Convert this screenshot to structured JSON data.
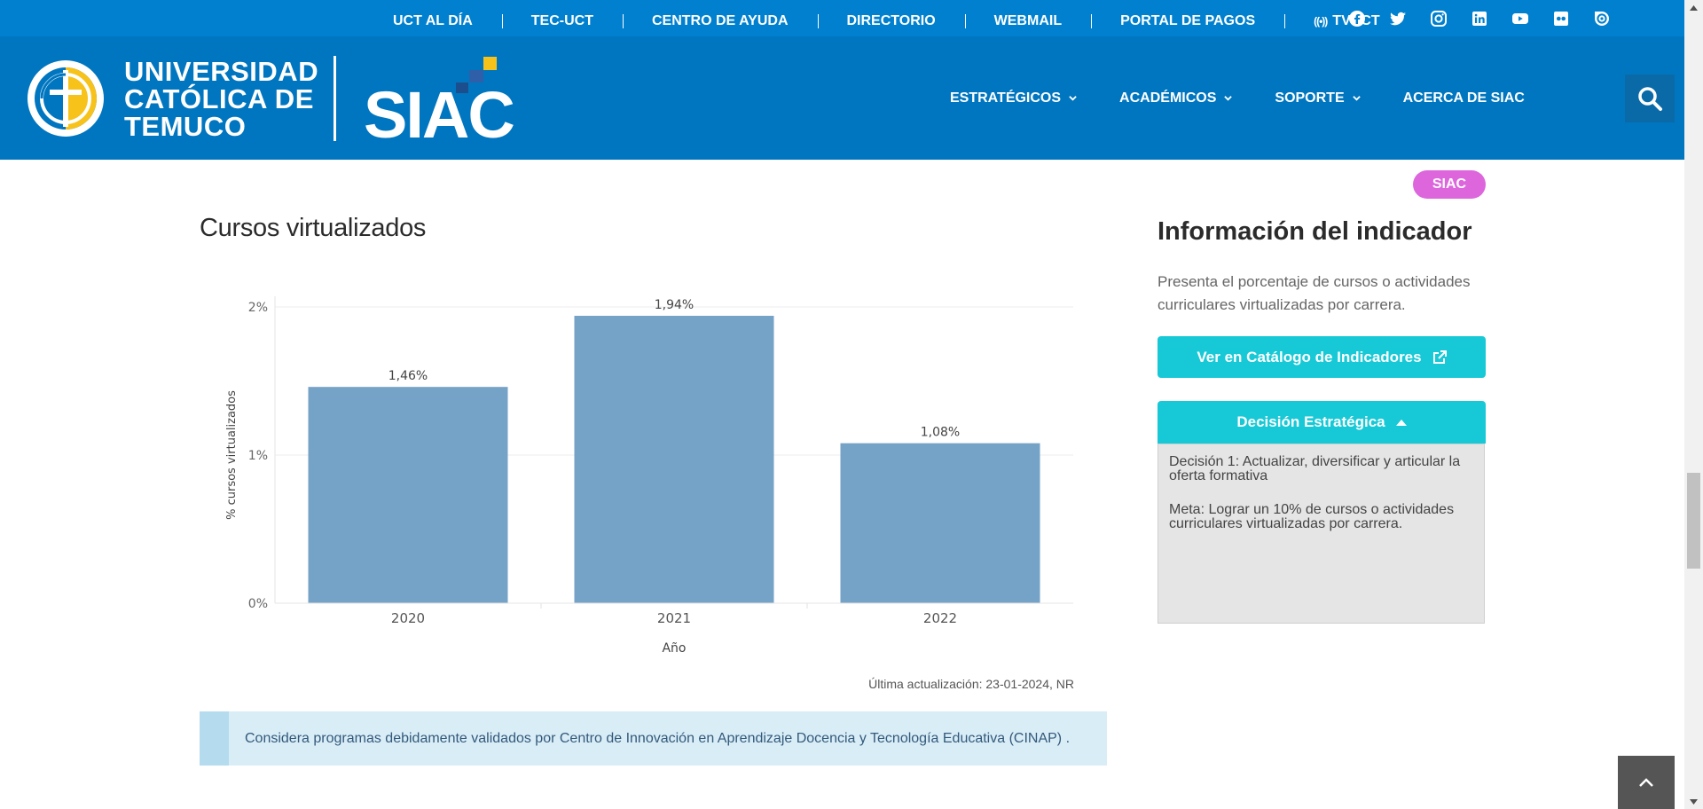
{
  "topbar": {
    "links": [
      "UCT AL DÍA",
      "TEC-UCT",
      "CENTRO DE AYUDA",
      "DIRECTORIO",
      "WEBMAIL",
      "PORTAL DE PAGOS",
      "TVUCT"
    ],
    "social_icons": [
      "facebook-icon",
      "twitter-icon",
      "instagram-icon",
      "linkedin-icon",
      "youtube-icon",
      "flickr-icon",
      "issuu-icon"
    ]
  },
  "header": {
    "university_name": [
      "UNIVERSIDAD",
      "CATÓLICA DE",
      "TEMUCO"
    ],
    "nav": [
      {
        "label": "ESTRATÉGICOS",
        "dropdown": true
      },
      {
        "label": "ACADÉMICOS",
        "dropdown": true
      },
      {
        "label": "SOPORTE",
        "dropdown": true
      },
      {
        "label": "ACERCA DE SIAC",
        "dropdown": false
      }
    ]
  },
  "badge": "SIAC",
  "chart_section": {
    "title": "Cursos virtualizados",
    "updated": "Última actualización: 23-01-2024, NR",
    "note": "Considera programas debidamente validados por Centro de Innovación en Aprendizaje Docencia y Tecnología Educativa (CINAP) ."
  },
  "chart_data": {
    "type": "bar",
    "title": "",
    "xlabel": "Año",
    "ylabel": "% cursos virtualizados",
    "categories": [
      "2020",
      "2021",
      "2022"
    ],
    "values": [
      1.46,
      1.94,
      1.08
    ],
    "value_labels": [
      "1,46%",
      "1,94%",
      "1,08%"
    ],
    "ylim": [
      0,
      2
    ],
    "yticks": [
      0,
      1,
      2
    ],
    "ytick_labels": [
      "0%",
      "1%",
      "2%"
    ],
    "grid": true,
    "bar_color": "#75a2c7"
  },
  "sidebar": {
    "title": "Información del indicador",
    "description": "Presenta el porcentaje de cursos o actividades curriculares virtualizadas por carrera.",
    "catalog_button": "Ver en Catálogo de Indicadores",
    "accordion_title": "Decisión Estratégica",
    "accordion_items": [
      "Decisión 1: Actualizar, diversificar y articular la oferta formativa",
      "Meta: Lograr un 10% de cursos o actividades curriculares virtualizadas por carrera."
    ]
  },
  "colors": {
    "topbar": "#0080cf",
    "header": "#0076c0",
    "accent": "#17c9d6",
    "badge": "#dd66dd",
    "logo_yellow": "#f7c21a"
  }
}
